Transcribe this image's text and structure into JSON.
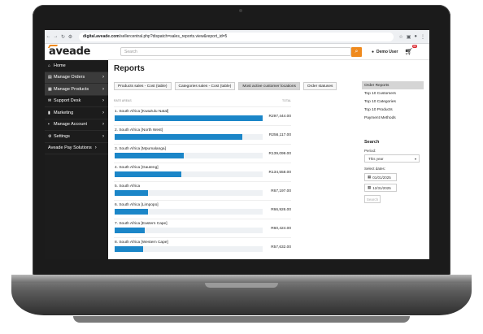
{
  "browser": {
    "url_host": "digital.aveade.com",
    "url_path": "/sellercentral.php?dispatch=sales_reports.view&report_id=5"
  },
  "header": {
    "logo": "aveade",
    "search_placeholder": "Search",
    "user_name": "Demo User",
    "cart_count": "35"
  },
  "sidebar": {
    "items": [
      {
        "label": "Home",
        "icon": "home-icon"
      },
      {
        "label": "Manage Orders",
        "icon": "orders-icon"
      },
      {
        "label": "Manage Products",
        "icon": "products-icon"
      },
      {
        "label": "Support Desk",
        "icon": "support-icon"
      },
      {
        "label": "Marketing",
        "icon": "marketing-icon"
      },
      {
        "label": "Manage Account",
        "icon": "account-icon"
      },
      {
        "label": "Settings",
        "icon": "settings-icon"
      },
      {
        "label": "Aveade Pay Solutions",
        "icon": ""
      }
    ]
  },
  "main": {
    "title": "Reports",
    "tabs": [
      {
        "label": "Products sales - Cost (table)"
      },
      {
        "label": "Categories sales - Cost (table)"
      },
      {
        "label": "Most active customer locations"
      },
      {
        "label": "Order statuses"
      }
    ],
    "chart_head_left": "RATE AREAS",
    "chart_head_right": "TOTAL"
  },
  "chart_data": {
    "type": "bar",
    "categories": [
      "1. South Africa [KwaZulu Natal]",
      "2. South Africa [North West]",
      "3. South Africa [Mpumalanga]",
      "4. South Africa [Gauteng]",
      "5. South Africa",
      "6. South Africa [Limpopo]",
      "7. South Africa [Eastern Cape]",
      "8. South Africa [Western Cape]"
    ],
    "values": [
      297444.0,
      256117.0,
      139099.0,
      134558.0,
      67197.0,
      66926.0,
      60424.0,
      57632.0
    ],
    "value_labels": [
      "R297,444.00",
      "R256,117.00",
      "R139,099.00",
      "R134,558.00",
      "R67,197.00",
      "R66,926.00",
      "R60,424.00",
      "R57,632.00"
    ],
    "max": 297444.0
  },
  "right_panel": {
    "menu": [
      {
        "label": "Order Reports"
      },
      {
        "label": "Top 10 Customers"
      },
      {
        "label": "Top 10 Categories"
      },
      {
        "label": "Top 10 Products"
      },
      {
        "label": "Payment Methods"
      }
    ],
    "search_title": "Search",
    "period_label": "Period:",
    "period_value": "This year",
    "dates_label": "Select dates:",
    "date_from": "01/01/2025",
    "date_to": "12/31/2025",
    "search_button": "Search"
  }
}
